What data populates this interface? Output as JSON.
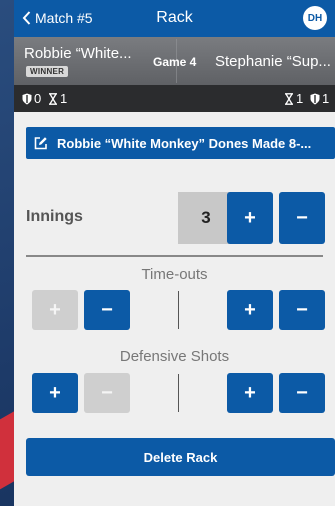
{
  "header": {
    "back_label": "Match #5",
    "title": "Rack",
    "avatar_initials": "DH"
  },
  "players": {
    "player1": "Robbie “White...",
    "player1_badge": "WINNER",
    "game": "Game 4",
    "player2": "Stephanie “Sup..."
  },
  "stats": {
    "p1_defensive": "0",
    "p1_timeouts": "1",
    "p2_timeouts": "1",
    "p2_defensive": "1"
  },
  "summary": {
    "text": "Robbie “White Monkey” Dones Made 8-..."
  },
  "innings": {
    "label": "Innings",
    "value": "3",
    "plus": "+",
    "minus": "−"
  },
  "timeouts": {
    "label": "Time-outs",
    "plus": "+",
    "minus": "−"
  },
  "defensive": {
    "label": "Defensive Shots",
    "plus": "+",
    "minus": "−"
  },
  "actions": {
    "delete_label": "Delete Rack"
  },
  "colors": {
    "accent": "#0c5aa6",
    "disabled": "#cfcfcf",
    "background": "#efefef"
  },
  "icons": [
    "chevron-left-icon",
    "shield-icon",
    "hourglass-icon",
    "edit-icon"
  ]
}
